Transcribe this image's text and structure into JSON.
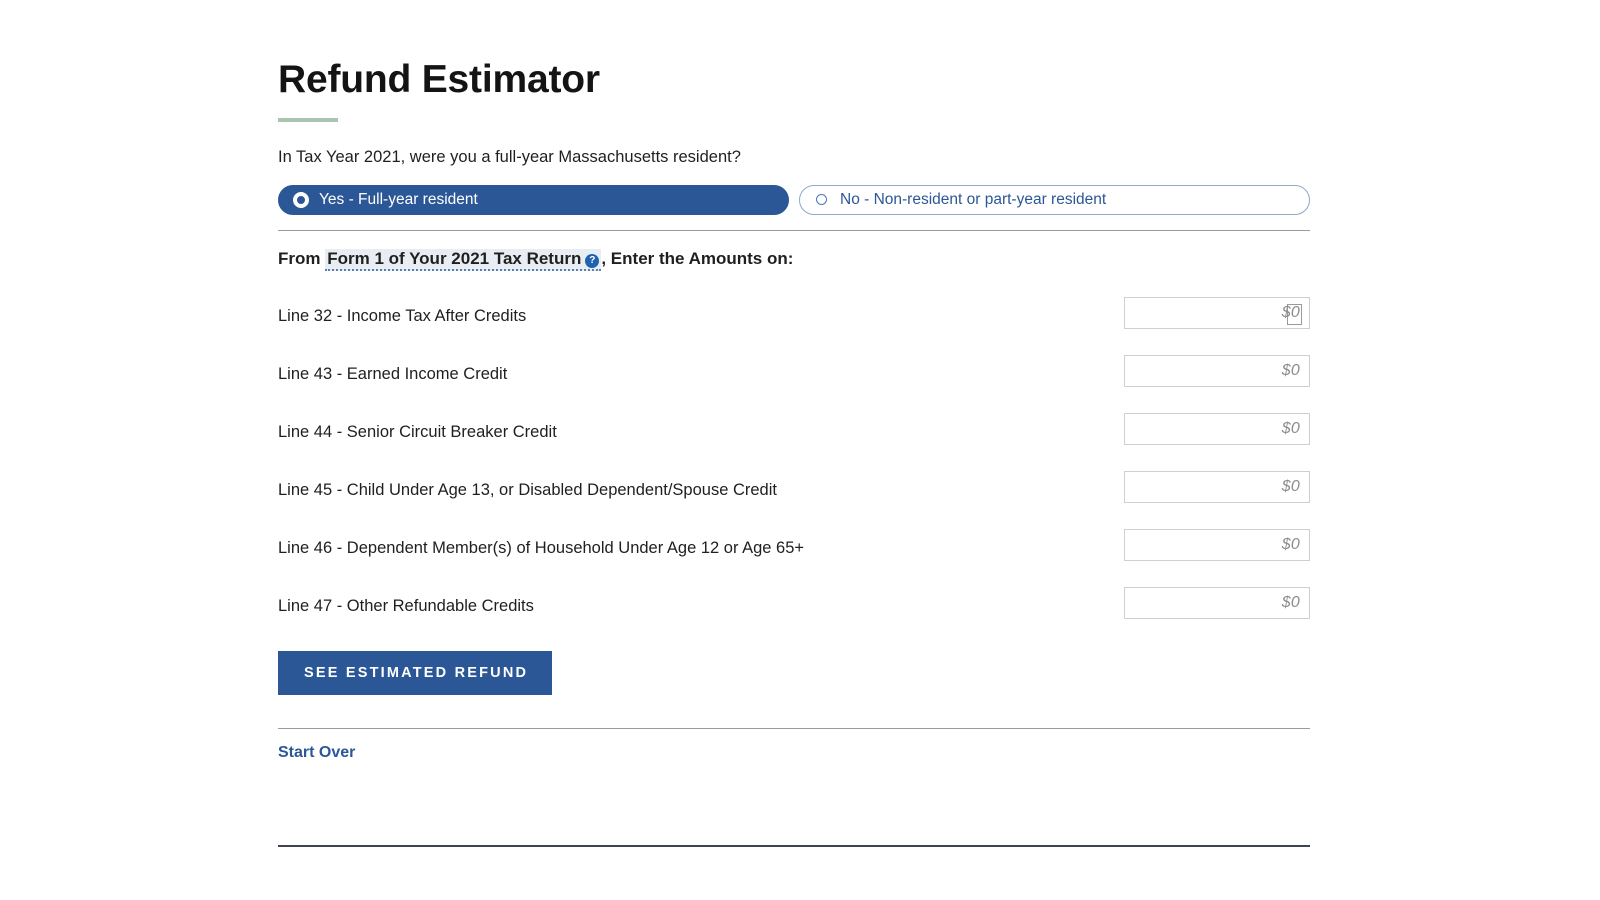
{
  "page": {
    "title": "Refund Estimator",
    "accent_color": "#a9c4b0",
    "brand_color": "#2b5797",
    "link_color": "#2b5797"
  },
  "residency_question": {
    "prompt": "In Tax Year 2021, were you a full-year Massachusetts resident?",
    "options": [
      {
        "label": "Yes - Full-year resident",
        "selected": true
      },
      {
        "label": "No - Non-resident or part-year resident",
        "selected": false
      }
    ]
  },
  "from_heading": {
    "prefix": "From",
    "link_text": "Form 1 of Your 2021 Tax Return",
    "help_icon": "question-mark-help-icon",
    "help_glyph": "?",
    "suffix": ", Enter the Amounts on:"
  },
  "line_items": [
    {
      "label": "Line 32 - Income Tax After Credits",
      "value": "",
      "placeholder": "$0",
      "focused": true
    },
    {
      "label": "Line 43 - Earned Income Credit",
      "value": "",
      "placeholder": "$0",
      "focused": false
    },
    {
      "label": "Line 44 - Senior Circuit Breaker Credit",
      "value": "",
      "placeholder": "$0",
      "focused": false
    },
    {
      "label": "Line 45 - Child Under Age 13, or Disabled Dependent/Spouse Credit",
      "value": "",
      "placeholder": "$0",
      "focused": false
    },
    {
      "label": "Line 46 - Dependent Member(s) of Household Under Age 12 or Age 65+",
      "value": "",
      "placeholder": "$0",
      "focused": false
    },
    {
      "label": "Line 47 - Other Refundable Credits",
      "value": "",
      "placeholder": "$0",
      "focused": false
    }
  ],
  "submit_button": {
    "label": "SEE ESTIMATED REFUND"
  },
  "start_over": {
    "label": "Start Over"
  }
}
